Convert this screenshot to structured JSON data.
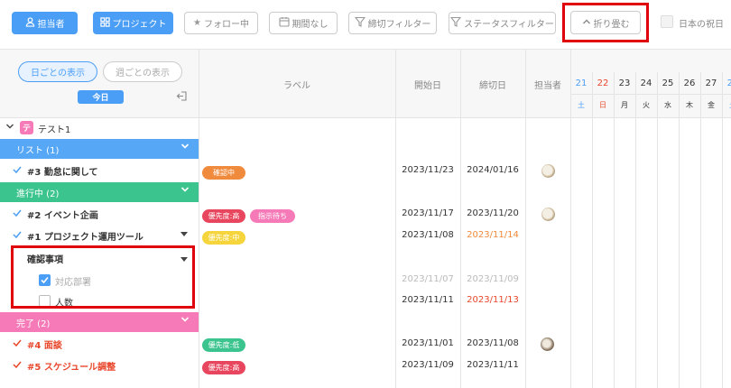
{
  "toolbar": {
    "assignee": "担当者",
    "project": "プロジェクト",
    "following": "フォロー中",
    "no_period": "期間なし",
    "deadline_filter": "締切フィルター",
    "status_filter": "ステータスフィルター",
    "collapse": "折り畳む",
    "jp_holidays": "日本の祝日"
  },
  "view": {
    "daily": "日ごとの表示",
    "weekly": "週ごとの表示",
    "today": "今日"
  },
  "columns": {
    "label": "ラベル",
    "start": "開始日",
    "deadline": "締切日",
    "assignee": "担当者"
  },
  "calendar": {
    "days": [
      "21",
      "22",
      "23",
      "24",
      "25",
      "26",
      "27",
      "28"
    ],
    "weekdays": [
      "土",
      "日",
      "月",
      "火",
      "水",
      "木",
      "金",
      "土"
    ]
  },
  "project": {
    "icon_char": "テ",
    "name": "テスト1"
  },
  "groups": {
    "list": "リスト (1)",
    "in_progress": "進行中 (2)",
    "done": "完了 (2)"
  },
  "tasks": [
    {
      "title": "#3 勤怠に関して",
      "labels": [
        "確認中"
      ],
      "start": "2023/11/23",
      "end": "2024/01/16"
    },
    {
      "title": "#2 イベント企画",
      "labels": [
        "優先度:高",
        "指示待ち"
      ],
      "start": "2023/11/17",
      "end": "2023/11/20"
    },
    {
      "title": "#1 プロジェクト運用ツール",
      "labels": [
        "優先度:中"
      ],
      "start": "2023/11/08",
      "end": "2023/11/14"
    },
    {
      "title": "#4 面談",
      "labels": [
        "優先度:低"
      ],
      "start": "2023/11/01",
      "end": "2023/11/08"
    },
    {
      "title": "#5 スケジュール調整",
      "labels": [
        "優先度:高"
      ],
      "start": "2023/11/09",
      "end": "2023/11/11"
    }
  ],
  "checklist": {
    "title": "確認事項",
    "items": [
      {
        "label": "対応部署",
        "checked": true,
        "start": "2023/11/07",
        "end": "2023/11/09"
      },
      {
        "label": "人数",
        "checked": false,
        "start": "2023/11/11",
        "end": "2023/11/13"
      }
    ]
  },
  "colors": {
    "blue": "#4b9ef5",
    "list_group": "#56a8f7",
    "progress_group": "#3cc48e",
    "done_group": "#f57ab7",
    "red_text": "#e8462a",
    "overdue_orange": "#f08a3c"
  },
  "icons": {
    "assignee": "person-icon",
    "project": "grid-icon",
    "following": "star-icon",
    "no_period": "calendar-icon",
    "filter": "filter-icon",
    "collapse": "chevron-up-icon",
    "export": "export-icon"
  }
}
